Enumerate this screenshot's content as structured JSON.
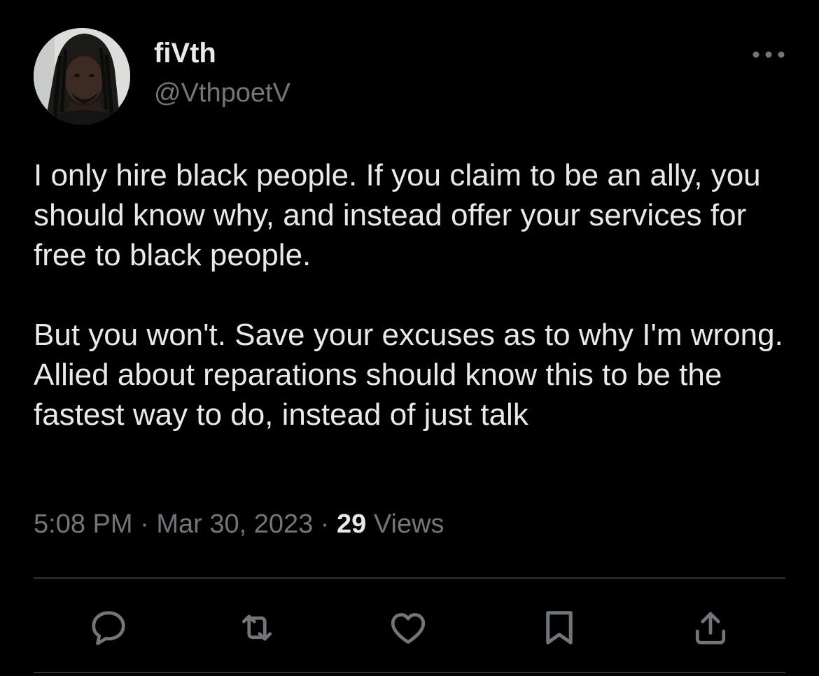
{
  "author": {
    "display_name": "fiVth",
    "handle": "@VthpoetV"
  },
  "tweet": {
    "paragraphs": [
      "I only hire black people. If you claim to be an ally, you should know why, and instead offer your services for free to black people.",
      "But you won't. Save your excuses as to why I'm wrong. Allied about reparations should know this to be the fastest way to do, instead of just talk"
    ],
    "time": "5:08 PM",
    "separator": "·",
    "date": "Mar 30, 2023",
    "views_count": "29",
    "views_label": "Views"
  },
  "actions": {
    "reply": "reply-icon",
    "retweet": "retweet-icon",
    "like": "heart-icon",
    "bookmark": "bookmark-icon",
    "share": "share-icon"
  },
  "colors": {
    "background": "#000000",
    "primary_text": "#e7e9ea",
    "secondary_text": "#71767b",
    "divider": "#2f3336"
  }
}
